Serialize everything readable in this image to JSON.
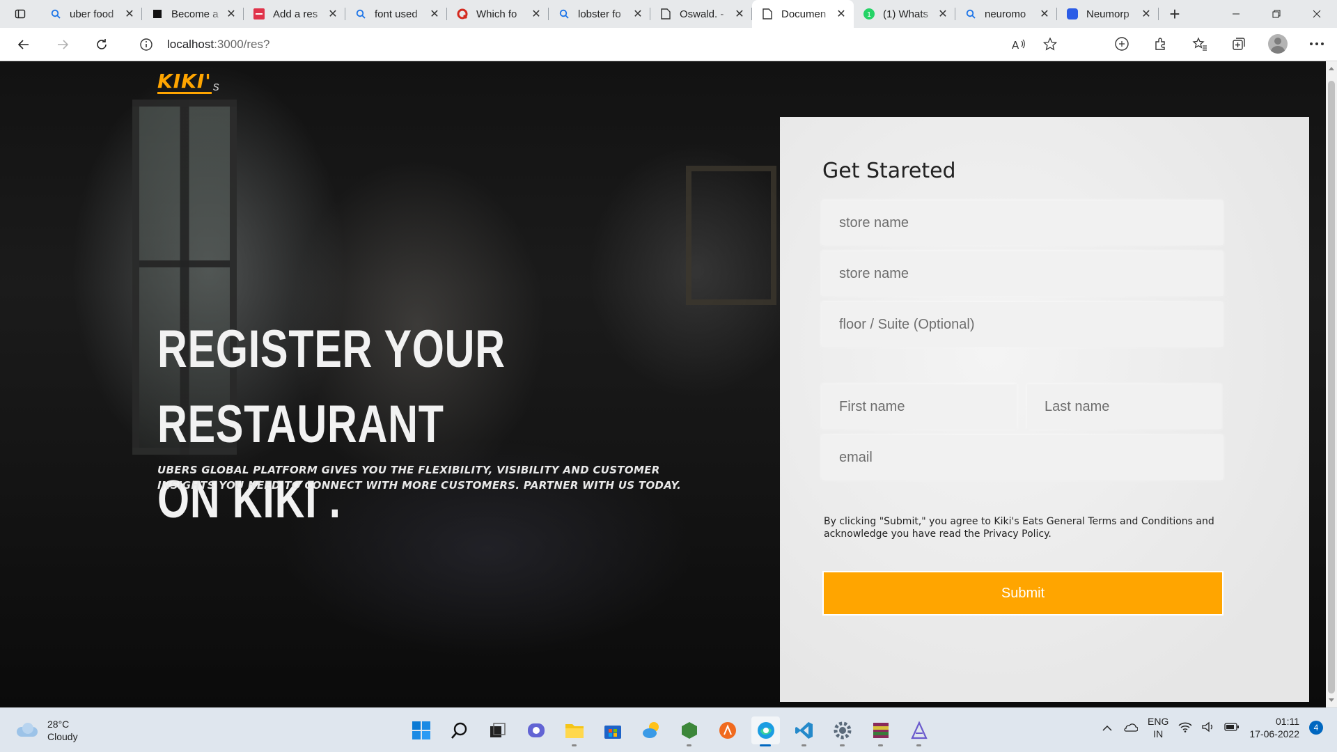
{
  "browser": {
    "tabs": [
      {
        "title": "uber food",
        "favicon": "search-icon",
        "active": false
      },
      {
        "title": "Become a",
        "favicon": "black-square-icon",
        "active": false
      },
      {
        "title": "Add a res",
        "favicon": "red-site-icon",
        "active": false
      },
      {
        "title": "font used",
        "favicon": "search-icon",
        "active": false
      },
      {
        "title": "Which fo",
        "favicon": "quora-icon",
        "active": false
      },
      {
        "title": "lobster fo",
        "favicon": "search-icon",
        "active": false
      },
      {
        "title": "Oswald. -",
        "favicon": "page-icon",
        "active": false
      },
      {
        "title": "Documen",
        "favicon": "page-icon",
        "active": true
      },
      {
        "title": "(1) Whats",
        "favicon": "whatsapp-icon",
        "active": false
      },
      {
        "title": "neuromo",
        "favicon": "search-icon",
        "active": false
      },
      {
        "title": "Neumorp",
        "favicon": "blue-site-icon",
        "active": false
      }
    ],
    "url": {
      "host": "localhost",
      "path": ":3000/res?"
    }
  },
  "page": {
    "logo": "KIKI'",
    "logo_suffix": "s",
    "hero_title_line1": "REGISTER YOUR RESTAURANT",
    "hero_title_line2": "ON KIKI .",
    "hero_subtitle": "Ubers global platform gives you the flexibility, visibility and customer insights you need to connect with more customers. Partner with us today.",
    "form": {
      "title": "Get Stareted",
      "store_name_1": "store name",
      "store_name_2": "store name",
      "floor_suite": "floor / Suite (Optional)",
      "first_name": "First name",
      "last_name": "Last name",
      "email": "email",
      "terms": "By clicking \"Submit,\" you agree to Kiki's Eats General Terms and Conditions and acknowledge you have read the Privacy Policy.",
      "submit": "Submit"
    },
    "accent_color": "#ffa500"
  },
  "taskbar": {
    "weather_temp": "28°C",
    "weather_desc": "Cloudy",
    "lang_1": "ENG",
    "lang_2": "IN",
    "time": "01:11",
    "date": "17-06-2022",
    "notifications": "4",
    "apps": [
      "start-icon",
      "search-icon",
      "task-view-icon",
      "teams-chat-icon",
      "file-explorer-icon",
      "store-icon",
      "weather-app-icon",
      "node-icon",
      "app-icon",
      "edge-icon",
      "vscode-icon",
      "settings-icon",
      "winrar-icon",
      "app-icon"
    ]
  }
}
